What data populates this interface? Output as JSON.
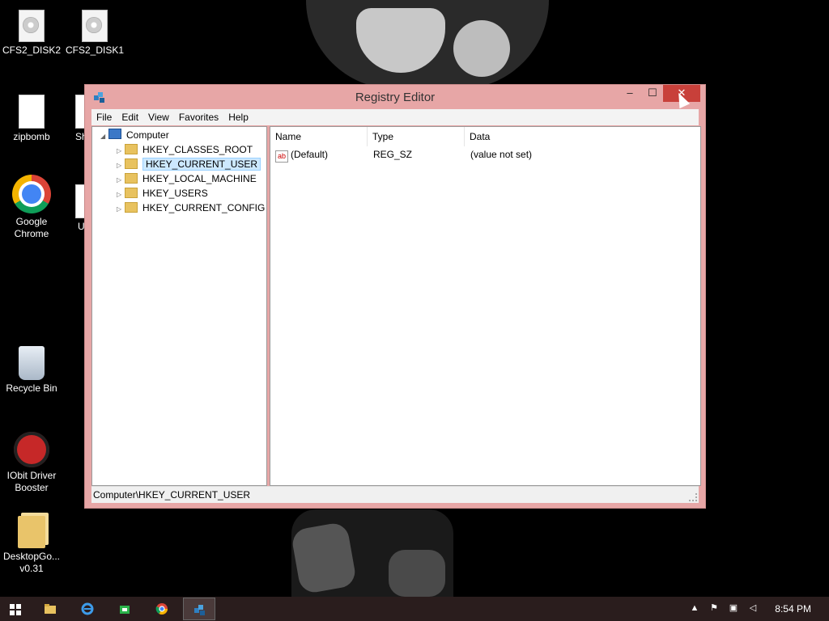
{
  "desktop": {
    "icons": [
      {
        "label": "CFS2_DISK2",
        "icon": "disc-icon"
      },
      {
        "label": "CFS2_DISK1",
        "icon": "disc-icon"
      },
      {
        "label": "zipbomb",
        "icon": "file-icon"
      },
      {
        "label": "Sh",
        "icon": "shortcut-icon"
      },
      {
        "label": "Google Chrome",
        "icon": "chrome-icon"
      },
      {
        "label": "U",
        "icon": "file-icon"
      },
      {
        "label": "Recycle Bin",
        "icon": "recycle-bin-icon"
      },
      {
        "label": "IObit Driver Booster",
        "icon": "iobit-icon"
      },
      {
        "label": "DesktopGo... v0.31",
        "icon": "folder-icon"
      }
    ]
  },
  "window": {
    "title": "Registry Editor",
    "controls": {
      "minimize": "–",
      "maximize": "☐",
      "close": "✕"
    },
    "menu": [
      "File",
      "Edit",
      "View",
      "Favorites",
      "Help"
    ],
    "tree": {
      "root": "Computer",
      "items": [
        {
          "label": "HKEY_CLASSES_ROOT",
          "selected": false
        },
        {
          "label": "HKEY_CURRENT_USER",
          "selected": true
        },
        {
          "label": "HKEY_LOCAL_MACHINE",
          "selected": false
        },
        {
          "label": "HKEY_USERS",
          "selected": false
        },
        {
          "label": "HKEY_CURRENT_CONFIG",
          "selected": false
        }
      ]
    },
    "list": {
      "columns": [
        "Name",
        "Type",
        "Data"
      ],
      "rows": [
        {
          "name": "(Default)",
          "type": "REG_SZ",
          "data": "(value not set)",
          "icon_label": "ab"
        }
      ]
    },
    "status": "Computer\\HKEY_CURRENT_USER"
  },
  "taskbar": {
    "apps": [
      "start-icon",
      "file-explorer-icon",
      "internet-explorer-icon",
      "store-icon",
      "chrome-icon",
      "regedit-icon"
    ],
    "active_app": "regedit-icon",
    "clock": "8:54 PM"
  },
  "colors": {
    "window_frame": "#e7a6a6",
    "close_button": "#c8403a",
    "selection": "#cce8ff",
    "taskbar": "#2a1d1d"
  }
}
